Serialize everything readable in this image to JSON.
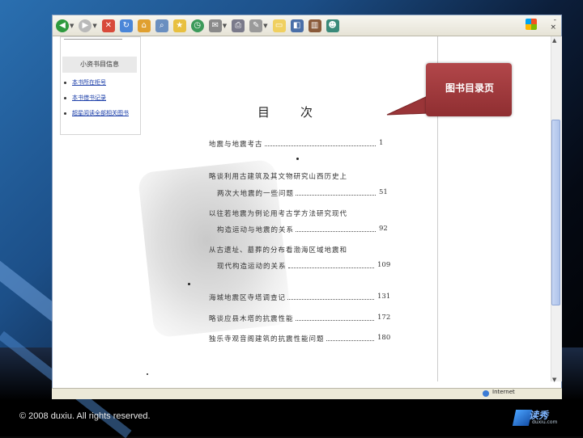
{
  "browser": {
    "toolbar_icons": [
      "back-icon",
      "forward-icon",
      "stop-icon",
      "refresh-icon",
      "home-icon",
      "search-icon",
      "favorites-icon",
      "history-icon",
      "mail-icon",
      "print-icon",
      "edit-icon",
      "folder-icon",
      "research-icon",
      "messenger-icon"
    ],
    "status_text": "Internet"
  },
  "sidebar": {
    "title": "小资书目信息",
    "items": [
      {
        "label": "本书所在柜号"
      },
      {
        "label": "本书借书记录"
      },
      {
        "label": "超星阅读全部相关图书"
      }
    ]
  },
  "document": {
    "title": "目次",
    "entries": [
      {
        "lines": [
          "地震与地震考古"
        ],
        "page": "1"
      },
      {
        "lines": [
          "略谈利用古建筑及其文物研究山西历史上",
          "两次大地震的一些问题"
        ],
        "page": "51"
      },
      {
        "lines": [
          "以往若地震为例论用考古学方法研究现代",
          "构造运动与地震的关系"
        ],
        "page": "92"
      },
      {
        "lines": [
          "从古遗址、墓葬的分布看渤海区域地震和",
          "现代构造运动的关系"
        ],
        "page": "109"
      },
      {
        "lines": [
          "海城地震区寺塔调查记"
        ],
        "page": "131"
      },
      {
        "lines": [
          "略谈应县木塔的抗震性能"
        ],
        "page": "172"
      },
      {
        "lines": [
          "独乐寺观音阁建筑的抗震性能问题"
        ],
        "page": "180"
      }
    ]
  },
  "callout": {
    "text": "图书目录页"
  },
  "footer": {
    "copyright": "© 2008 duxiu. All rights reserved.",
    "logo_cn": "读秀",
    "logo_sub": "duxiu.com"
  },
  "colors": {
    "callout": "#a33c3f",
    "link": "#1a3da8"
  }
}
